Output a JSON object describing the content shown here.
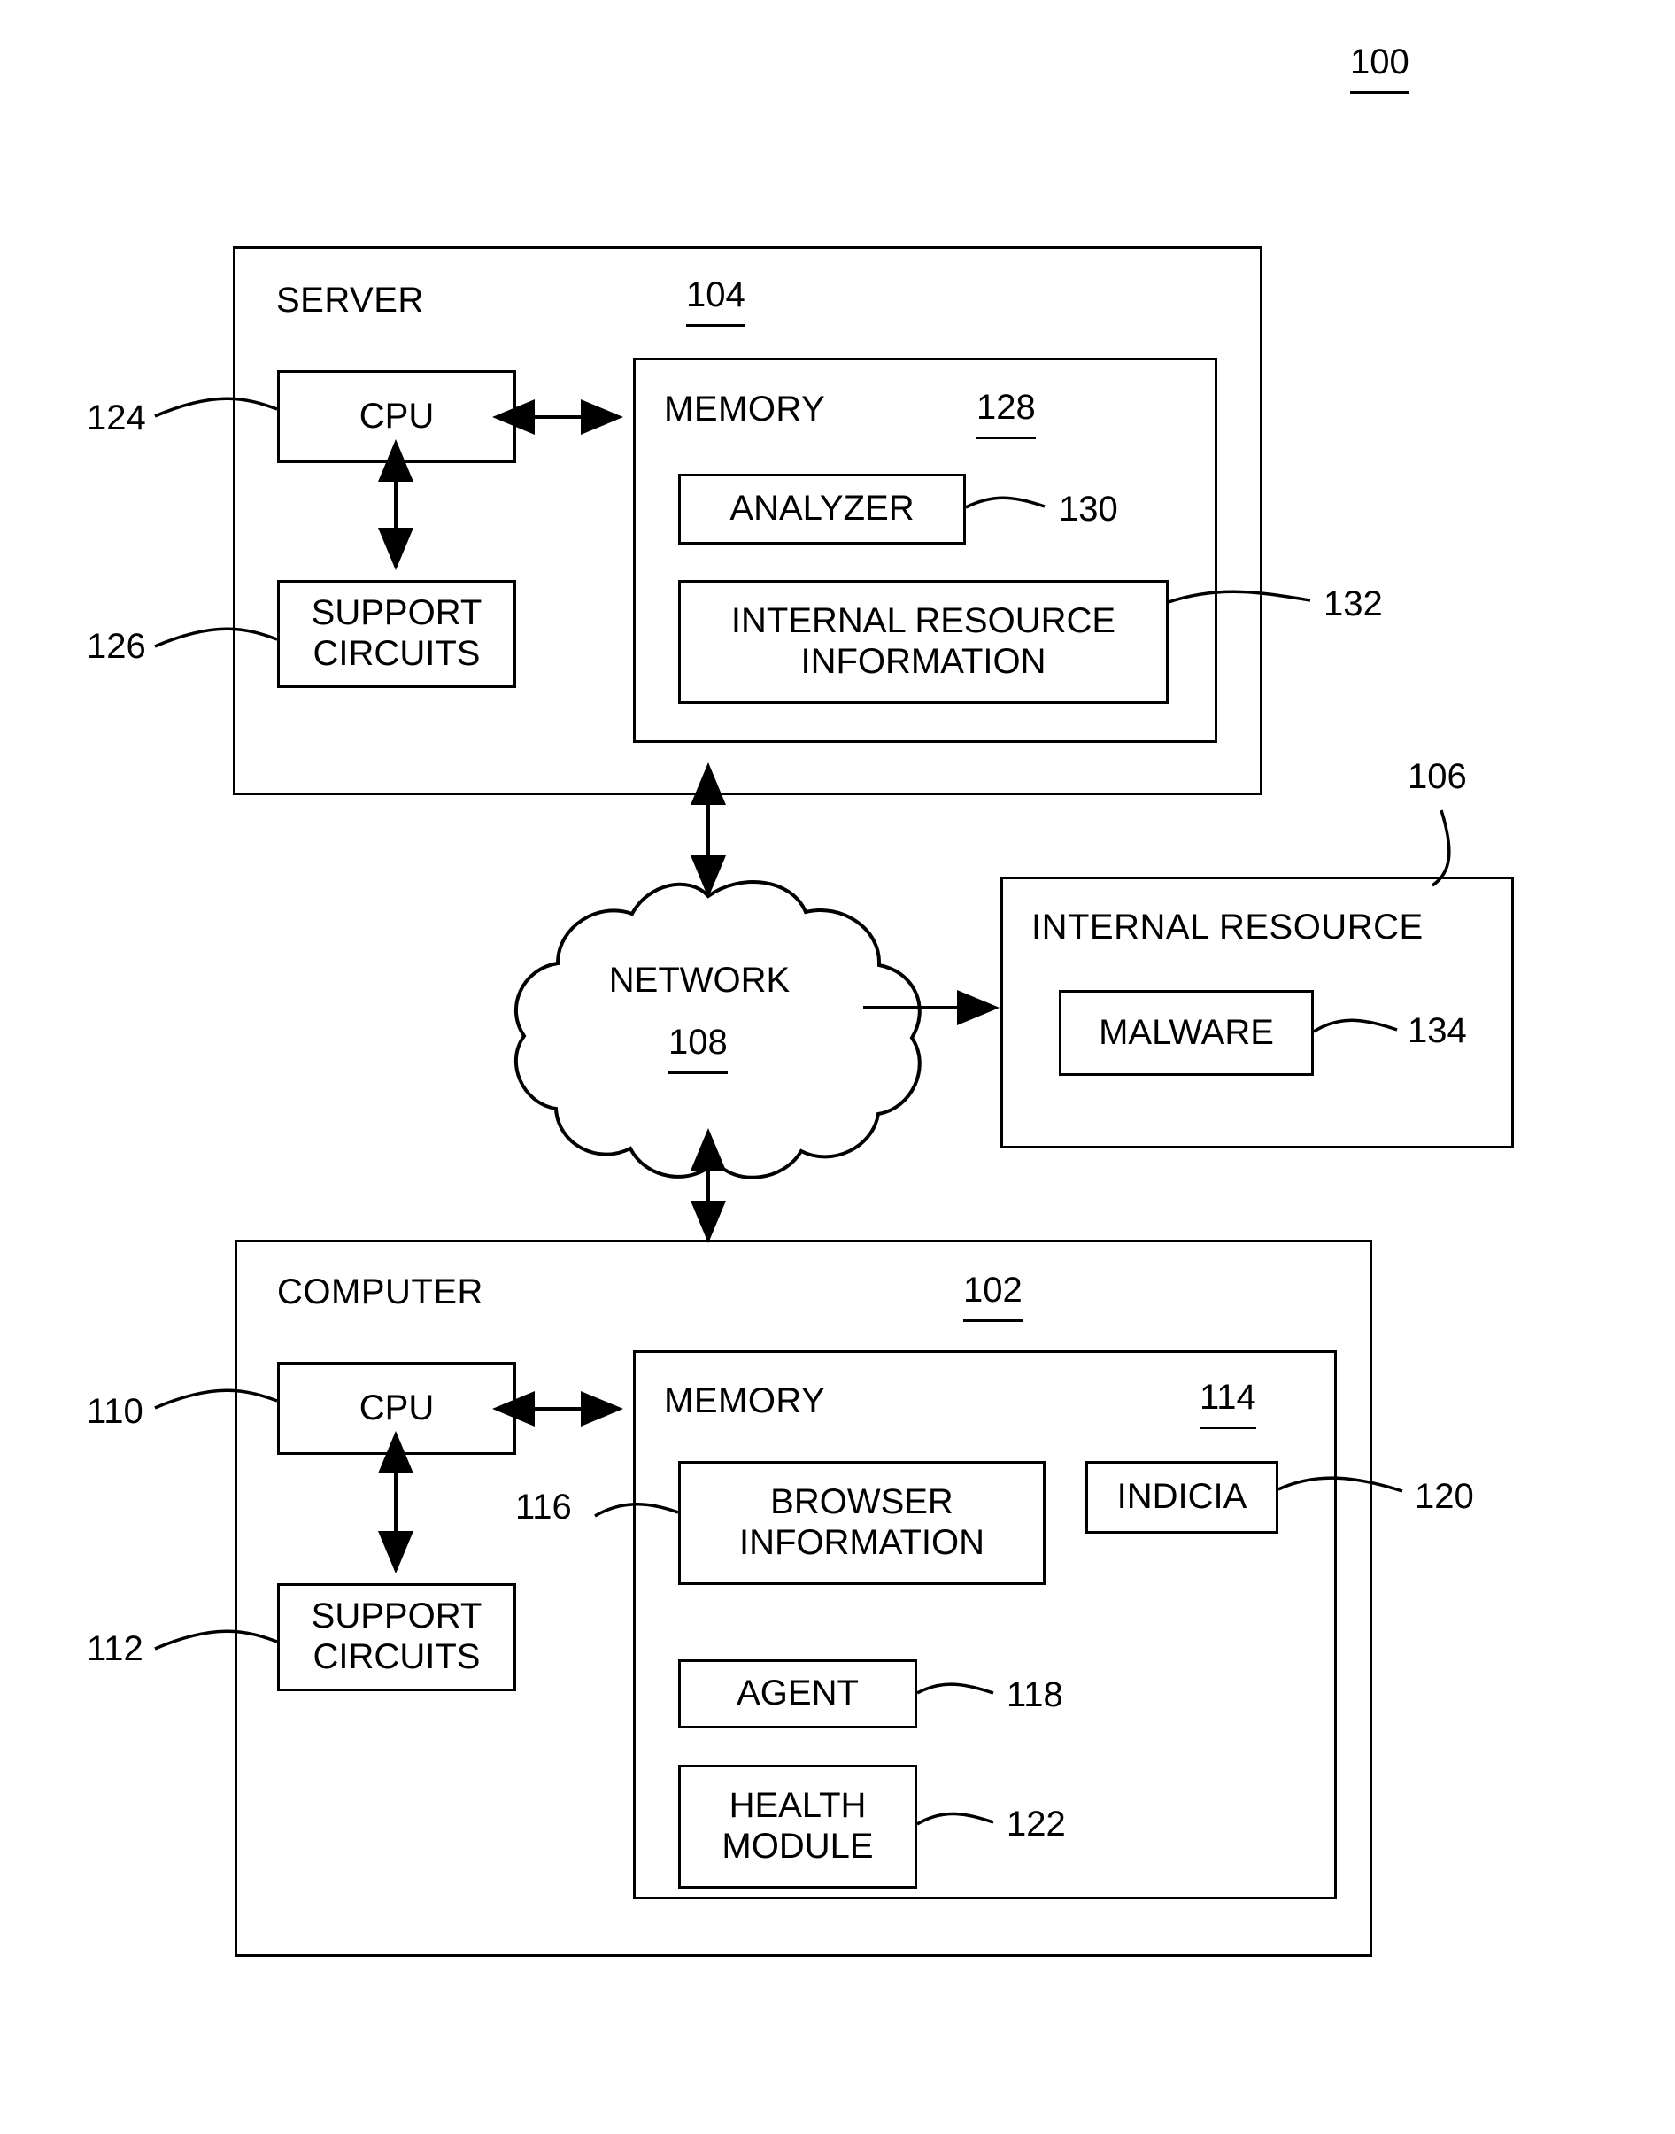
{
  "figure": {
    "number": "100"
  },
  "server": {
    "title": "SERVER",
    "ref": "104",
    "cpu": {
      "label": "CPU",
      "ref": "124"
    },
    "support_circuits": {
      "label": "SUPPORT\nCIRCUITS",
      "ref": "126"
    },
    "memory": {
      "label": "MEMORY",
      "ref": "128",
      "analyzer": {
        "label": "ANALYZER",
        "ref": "130"
      },
      "internal_resource_information": {
        "label": "INTERNAL RESOURCE\nINFORMATION",
        "ref": "132"
      }
    }
  },
  "network": {
    "label": "NETWORK",
    "ref": "108"
  },
  "internal_resource": {
    "title": "INTERNAL RESOURCE",
    "ref": "106",
    "malware": {
      "label": "MALWARE",
      "ref": "134"
    }
  },
  "computer": {
    "title": "COMPUTER",
    "ref": "102",
    "cpu": {
      "label": "CPU",
      "ref": "110"
    },
    "support_circuits": {
      "label": "SUPPORT\nCIRCUITS",
      "ref": "112"
    },
    "memory": {
      "label": "MEMORY",
      "ref": "114",
      "browser_information": {
        "label": "BROWSER\nINFORMATION",
        "ref": "116"
      },
      "agent": {
        "label": "AGENT",
        "ref": "118"
      },
      "indicia": {
        "label": "INDICIA",
        "ref": "120"
      },
      "health_module": {
        "label": "HEALTH\nMODULE",
        "ref": "122"
      }
    }
  },
  "colors": {
    "ink": "#000000",
    "paper": "#ffffff"
  }
}
